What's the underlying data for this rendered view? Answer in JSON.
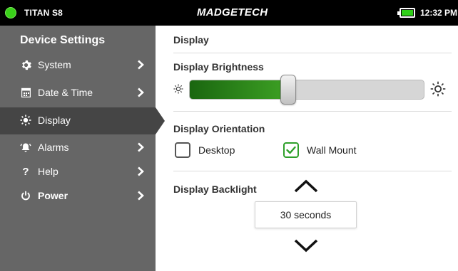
{
  "status_bar": {
    "device_name": "TITAN S8",
    "brand": "MADGETECH",
    "time": "12:32 PM",
    "led_color": "#39d019",
    "battery_icon": "battery-full-icon"
  },
  "sidebar": {
    "title": "Device Settings",
    "items": [
      {
        "label": "System",
        "icon": "gear-icon",
        "has_chevron": true
      },
      {
        "label": "Date & Time",
        "icon": "calendar-icon",
        "has_chevron": true
      },
      {
        "label": "Display",
        "icon": "sun-icon",
        "has_chevron": false,
        "active": true
      },
      {
        "label": "Alarms",
        "icon": "alarm-bell-icon",
        "has_chevron": true
      },
      {
        "label": "Help",
        "icon": "question-icon",
        "has_chevron": true
      },
      {
        "label": "Power",
        "icon": "power-icon",
        "has_chevron": true
      }
    ]
  },
  "main": {
    "section_title": "Display",
    "brightness": {
      "label": "Display Brightness",
      "level": 0.4,
      "accent_color": "#2b8a1b"
    },
    "orientation": {
      "label": "Display Orientation",
      "options": [
        {
          "label": "Desktop",
          "checked": false
        },
        {
          "label": "Wall Mount",
          "checked": true
        }
      ]
    },
    "backlight": {
      "label": "Display Backlight",
      "value": "30 seconds"
    }
  }
}
